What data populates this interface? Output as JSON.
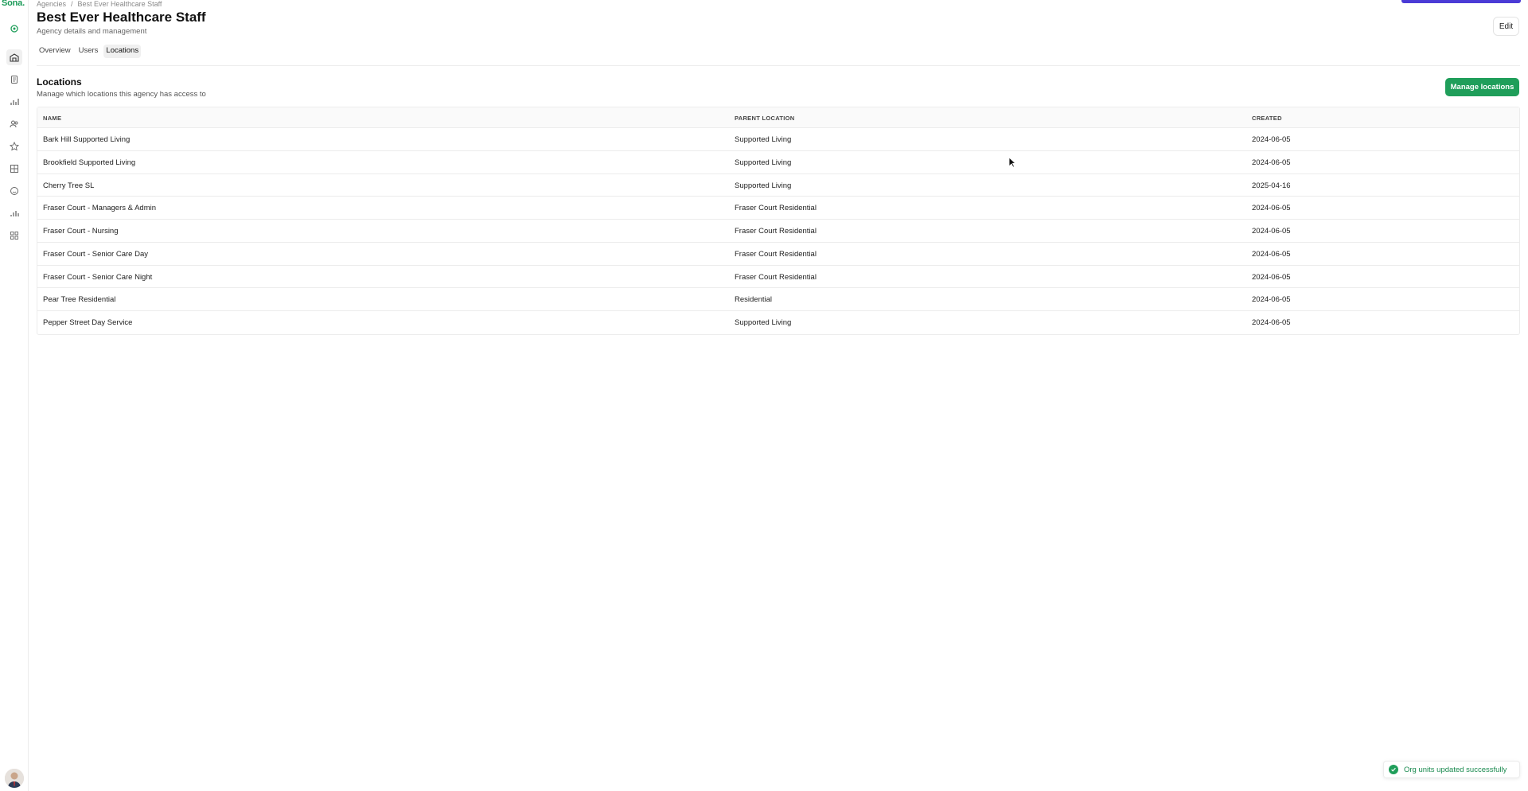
{
  "app": {
    "logo": "Sona."
  },
  "breadcrumb": {
    "parent": "Agencies",
    "separator": "/",
    "current": "Best Ever Healthcare Staff"
  },
  "header": {
    "title": "Best Ever Healthcare Staff",
    "subtitle": "Agency details and management",
    "edit_label": "Edit"
  },
  "tabs": [
    {
      "label": "Overview",
      "active": false
    },
    {
      "label": "Users",
      "active": false
    },
    {
      "label": "Locations",
      "active": true
    }
  ],
  "locations": {
    "title": "Locations",
    "subtitle": "Manage which locations this agency has access to",
    "manage_label": "Manage locations",
    "columns": [
      "NAME",
      "PARENT LOCATION",
      "CREATED"
    ],
    "rows": [
      {
        "name": "Bark Hill Supported Living",
        "parent": "Supported Living",
        "created": "2024-06-05"
      },
      {
        "name": "Brookfield Supported Living",
        "parent": "Supported Living",
        "created": "2024-06-05"
      },
      {
        "name": "Cherry Tree SL",
        "parent": "Supported Living",
        "created": "2025-04-16"
      },
      {
        "name": "Fraser Court - Managers & Admin",
        "parent": "Fraser Court Residential",
        "created": "2024-06-05"
      },
      {
        "name": "Fraser Court - Nursing",
        "parent": "Fraser Court Residential",
        "created": "2024-06-05"
      },
      {
        "name": "Fraser Court - Senior Care Day",
        "parent": "Fraser Court Residential",
        "created": "2024-06-05"
      },
      {
        "name": "Fraser Court - Senior Care Night",
        "parent": "Fraser Court Residential",
        "created": "2024-06-05"
      },
      {
        "name": "Pear Tree Residential",
        "parent": "Residential",
        "created": "2024-06-05"
      },
      {
        "name": "Pepper Street Day Service",
        "parent": "Supported Living",
        "created": "2024-06-05"
      }
    ]
  },
  "toast": {
    "message": "Org units updated successfully"
  },
  "sidebar": {
    "icons": [
      "home-icon",
      "building-icon",
      "documents-icon",
      "bar-chart-icon",
      "users-icon",
      "star-icon",
      "grid-icon",
      "smile-icon",
      "analytics-icon",
      "apps-icon"
    ]
  },
  "colors": {
    "brand": "#1f9e5a",
    "accent": "#4b3bd6"
  }
}
